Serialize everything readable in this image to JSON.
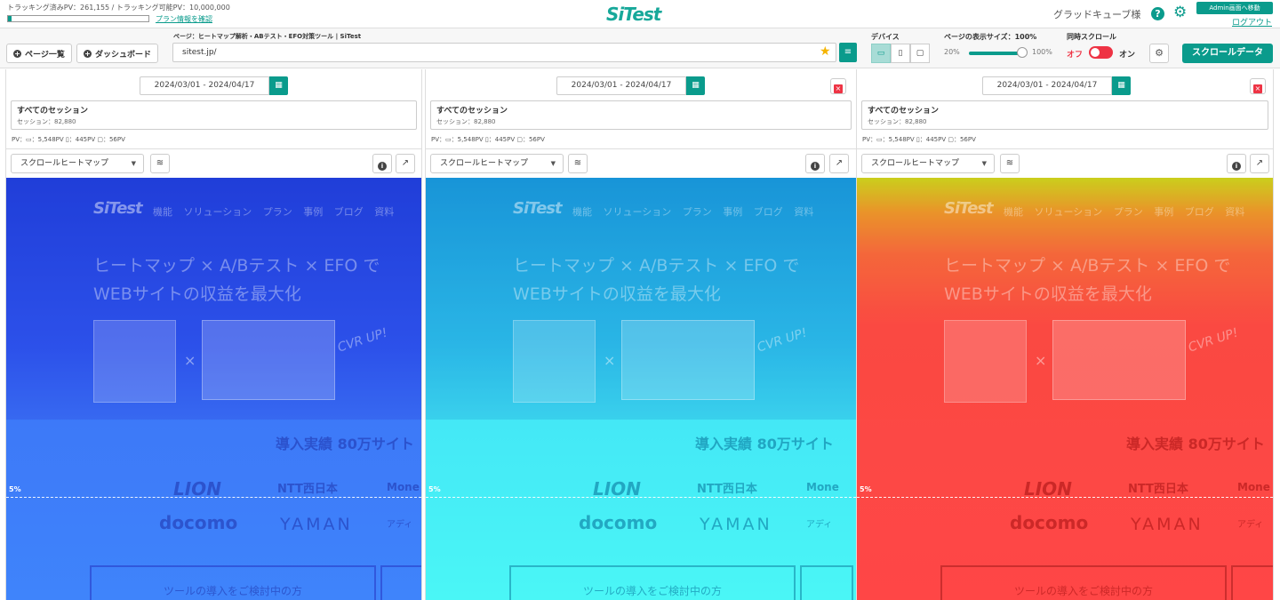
{
  "header": {
    "tracking_text": "トラッキング済みPV：261,155 / トラッキング可能PV：10,000,000",
    "tracking_ratio": 0.026,
    "plan_link": "プラン情報を確認",
    "logo": "SiTest",
    "user": "グラッドキューブ様",
    "help_icon": "?",
    "gear_icon": "⚙",
    "admin_button": "Admin画面へ移動",
    "logout": "ログアウト"
  },
  "toolbar": {
    "page_list_button": "ページ一覧",
    "dashboard_button": "ダッシュボード",
    "page_label": "ページ：ヒートマップ解析・ABテスト・EFO対策ツール | SiTest",
    "url": "sitest.jp/",
    "star_icon": "★",
    "device_label": "デバイス",
    "devices": [
      "▭",
      "▯",
      "▢"
    ],
    "page_size_label": "ページの表示サイズ：100%",
    "size_min": "20%",
    "size_max": "100%",
    "size_value": 1.0,
    "sync_scroll_label": "同時スクロール",
    "sync_off": "オフ",
    "sync_on": "オン",
    "scroll_data_button": "スクロールデータ"
  },
  "panels": [
    {
      "date_range": "2024/03/01 - 2024/04/17",
      "segment_title": "すべてのセッション",
      "segment_sub": "セッション：82,880",
      "pv": "PV：▭：5,548PV ▯：445PV ▢：56PV",
      "heatmap_select": "スクロールヒートマップ",
      "theme": "blue",
      "closable": false
    },
    {
      "date_range": "2024/03/01 - 2024/04/17",
      "segment_title": "すべてのセッション",
      "segment_sub": "セッション：82,880",
      "pv": "PV：▭：5,548PV ▯：445PV ▢：56PV",
      "heatmap_select": "スクロールヒートマップ",
      "theme": "cyan",
      "closable": true
    },
    {
      "date_range": "2024/03/01 - 2024/04/17",
      "segment_title": "すべてのセッション",
      "segment_sub": "セッション：82,880",
      "pv": "PV：▭：5,548PV ▯：445PV ▢：56PV",
      "heatmap_select": "スクロールヒートマップ",
      "theme": "red",
      "closable": true
    }
  ],
  "site": {
    "logo": "SiTest",
    "nav": "機能 ソリューション プラン 事例 ブログ 資料",
    "hero_line1": "ヒートマップ × A/Bテスト × EFO で",
    "hero_line2": "WEBサイトの収益を最大化",
    "times": "×",
    "cvr": "CVR UP!",
    "achievement": "導入実績 80万サイト",
    "logos": {
      "lion": "LION",
      "ntt": "NTT西日本",
      "money": "Mone",
      "docomo": "docomo",
      "yaman": "YAMAN",
      "misc": "アディ"
    },
    "cta": "ツールの導入をご検討中の方",
    "scroll_marker": "5%"
  },
  "colors": {
    "accent": "#0a9b8c",
    "danger": "#ee3344"
  },
  "icons": {
    "calendar": "▦",
    "close": "×",
    "layers": "≋",
    "info": "i",
    "external": "↗",
    "doc": "≡",
    "caret": "▼",
    "plus": "+"
  }
}
